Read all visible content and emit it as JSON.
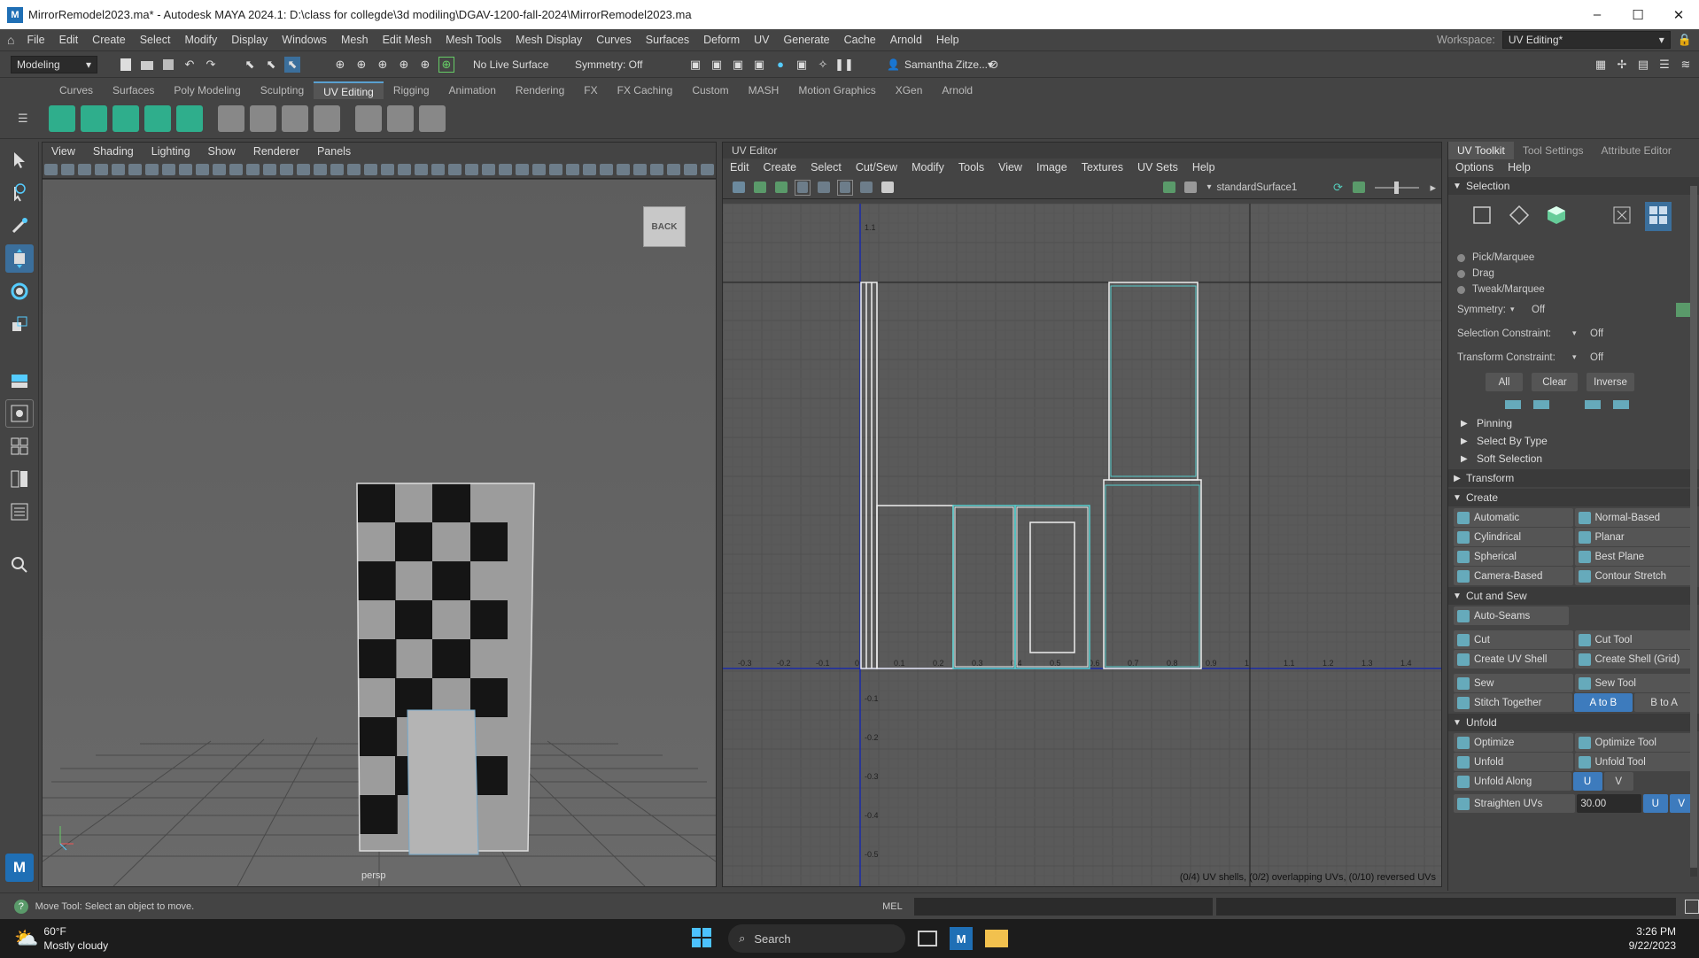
{
  "window": {
    "title": "MirrorRemodel2023.ma* - Autodesk MAYA 2024.1: D:\\class for collegde\\3d modiling\\DGAV-1200-fall-2024\\MirrorRemodel2023.ma",
    "minimize": "–",
    "maximize": "☐",
    "close": "✕"
  },
  "menubar": {
    "items": [
      "File",
      "Edit",
      "Create",
      "Select",
      "Modify",
      "Display",
      "Windows",
      "Mesh",
      "Edit Mesh",
      "Mesh Tools",
      "Mesh Display",
      "Curves",
      "Surfaces",
      "Deform",
      "UV",
      "Generate",
      "Cache",
      "Arnold",
      "Help"
    ],
    "workspace_label": "Workspace:",
    "workspace_value": "UV Editing*"
  },
  "statusline": {
    "mode": "Modeling",
    "live_surface": "No Live Surface",
    "symmetry": "Symmetry: Off",
    "user": "Samantha Zitze..."
  },
  "shelf": {
    "tabs": [
      "Curves",
      "Surfaces",
      "Poly Modeling",
      "Sculpting",
      "UV Editing",
      "Rigging",
      "Animation",
      "Rendering",
      "FX",
      "FX Caching",
      "Custom",
      "MASH",
      "Motion Graphics",
      "XGen",
      "Arnold"
    ],
    "active": "UV Editing",
    "icon_colors": [
      "#2fae8c",
      "#2fae8c",
      "#2fae8c",
      "#2fae8c",
      "#2fae8c",
      "#888",
      "#888",
      "#888",
      "#888",
      "#888",
      "#888",
      "#888"
    ]
  },
  "viewport": {
    "menu": [
      "View",
      "Shading",
      "Lighting",
      "Show",
      "Renderer",
      "Panels"
    ],
    "camera_label": "persp",
    "view_cube": "BACK"
  },
  "uv_editor": {
    "title": "UV Editor",
    "menu": [
      "Edit",
      "Create",
      "Select",
      "Cut/Sew",
      "Modify",
      "Tools",
      "View",
      "Image",
      "Textures",
      "UV Sets",
      "Help"
    ],
    "texture": "standardSurface1",
    "status": "(0/4) UV shells, (0/2) overlapping UVs, (0/10) reversed UVs",
    "x_ticks": [
      "-0.3",
      "-0.2",
      "-0.1",
      "0",
      "0.1",
      "0.2",
      "0.3",
      "0.4",
      "0.5",
      "0.6",
      "0.7",
      "0.8",
      "0.9",
      "1",
      "1.1",
      "1.2",
      "1.3",
      "1.4"
    ],
    "y_ticks": [
      "1.1",
      "-0.1",
      "-0.2",
      "-0.3",
      "-0.4",
      "-0.5"
    ]
  },
  "panel": {
    "tabs": [
      "UV Toolkit",
      "Tool Settings",
      "Attribute Editor"
    ],
    "menu": [
      "Options",
      "Help"
    ],
    "selection_title": "Selection",
    "radios": [
      "Pick/Marquee",
      "Drag",
      "Tweak/Marquee"
    ],
    "symmetry_label": "Symmetry:",
    "symmetry_value": "Off",
    "sel_constraint_label": "Selection Constraint:",
    "sel_constraint_value": "Off",
    "tr_constraint_label": "Transform Constraint:",
    "tr_constraint_value": "Off",
    "btn_all": "All",
    "btn_clear": "Clear",
    "btn_inverse": "Inverse",
    "subs": [
      "Pinning",
      "Select By Type",
      "Soft Selection"
    ],
    "transform_title": "Transform",
    "create_title": "Create",
    "create_btns": [
      [
        "Automatic",
        "Normal-Based"
      ],
      [
        "Cylindrical",
        "Planar"
      ],
      [
        "Spherical",
        "Best Plane"
      ],
      [
        "Camera-Based",
        "Contour Stretch"
      ]
    ],
    "cutsew_title": "Cut and Sew",
    "autoseams": "Auto-Seams",
    "cut_btns": [
      [
        "Cut",
        "Cut Tool"
      ],
      [
        "Create UV Shell",
        "Create Shell (Grid)"
      ]
    ],
    "sew_btns": [
      "Sew",
      "Sew Tool"
    ],
    "stitch": "Stitch Together",
    "atob": "A to B",
    "btoa": "B to A",
    "unfold_title": "Unfold",
    "unfold_btns": [
      [
        "Optimize",
        "Optimize Tool"
      ],
      [
        "Unfold",
        "Unfold Tool"
      ]
    ],
    "unfold_along": "Unfold Along",
    "u": "U",
    "v": "V",
    "straighten": "Straighten UVs",
    "straighten_value": "30.00"
  },
  "helpline": {
    "text": "Move Tool: Select an object to move.",
    "mel": "MEL"
  },
  "taskbar": {
    "temp": "60°F",
    "weather": "Mostly cloudy",
    "search": "Search",
    "time": "3:26 PM",
    "date": "9/22/2023"
  }
}
